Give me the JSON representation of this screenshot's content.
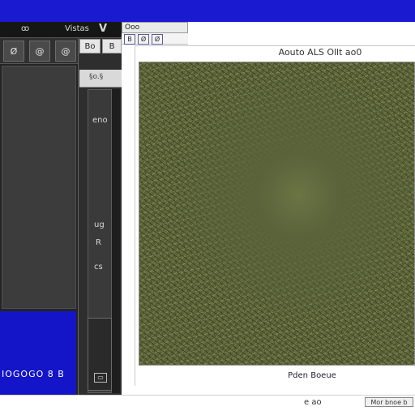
{
  "top_bar": {
    "color": "#1a1ad0"
  },
  "left_panel": {
    "header_left": "ꝏ",
    "header_mid": "Vistas",
    "header_right": "V",
    "tools": [
      "Ø",
      "@",
      "@"
    ],
    "footer_text": "IOGOGO 8 B"
  },
  "mid_panel": {
    "tabs": [
      "Bo",
      "B"
    ],
    "light_label": "§o.§",
    "labels": [
      "eno",
      "ug",
      "R",
      "cs"
    ]
  },
  "document": {
    "tab_title": "Ooo",
    "toolbar_icons": [
      "B",
      "Ø",
      "Ø"
    ],
    "image_title": "Aouto ALS Ollt ao0",
    "image_caption": "Pden Boeue"
  },
  "status_bar": {
    "center_text": "e  ao",
    "right_text": "Mor bnoe b"
  }
}
